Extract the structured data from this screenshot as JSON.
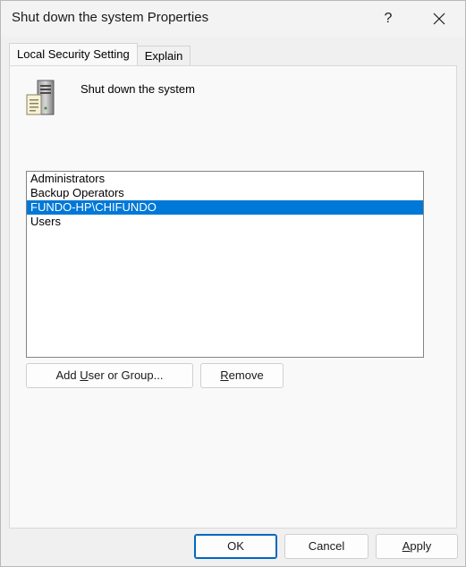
{
  "window": {
    "title": "Shut down the system Properties",
    "help_glyph": "?"
  },
  "tabs": [
    {
      "label": "Local Security Setting",
      "active": true
    },
    {
      "label": "Explain",
      "active": false
    }
  ],
  "policy": {
    "icon": "server-icon",
    "name": "Shut down the system"
  },
  "users_list": {
    "items": [
      {
        "label": "Administrators",
        "selected": false
      },
      {
        "label": "Backup Operators",
        "selected": false
      },
      {
        "label": "FUNDO-HP\\CHIFUNDO",
        "selected": true
      },
      {
        "label": "Users",
        "selected": false
      }
    ]
  },
  "actions": {
    "add": {
      "pre": "Add ",
      "accel": "U",
      "post": "ser or Group..."
    },
    "remove": {
      "pre": "",
      "accel": "R",
      "post": "emove"
    }
  },
  "footer": {
    "ok": "OK",
    "cancel": "Cancel",
    "apply": {
      "pre": "",
      "accel": "A",
      "post": "pply"
    }
  },
  "colors": {
    "selection": "#0078d7",
    "default_button_border": "#0067c0"
  }
}
